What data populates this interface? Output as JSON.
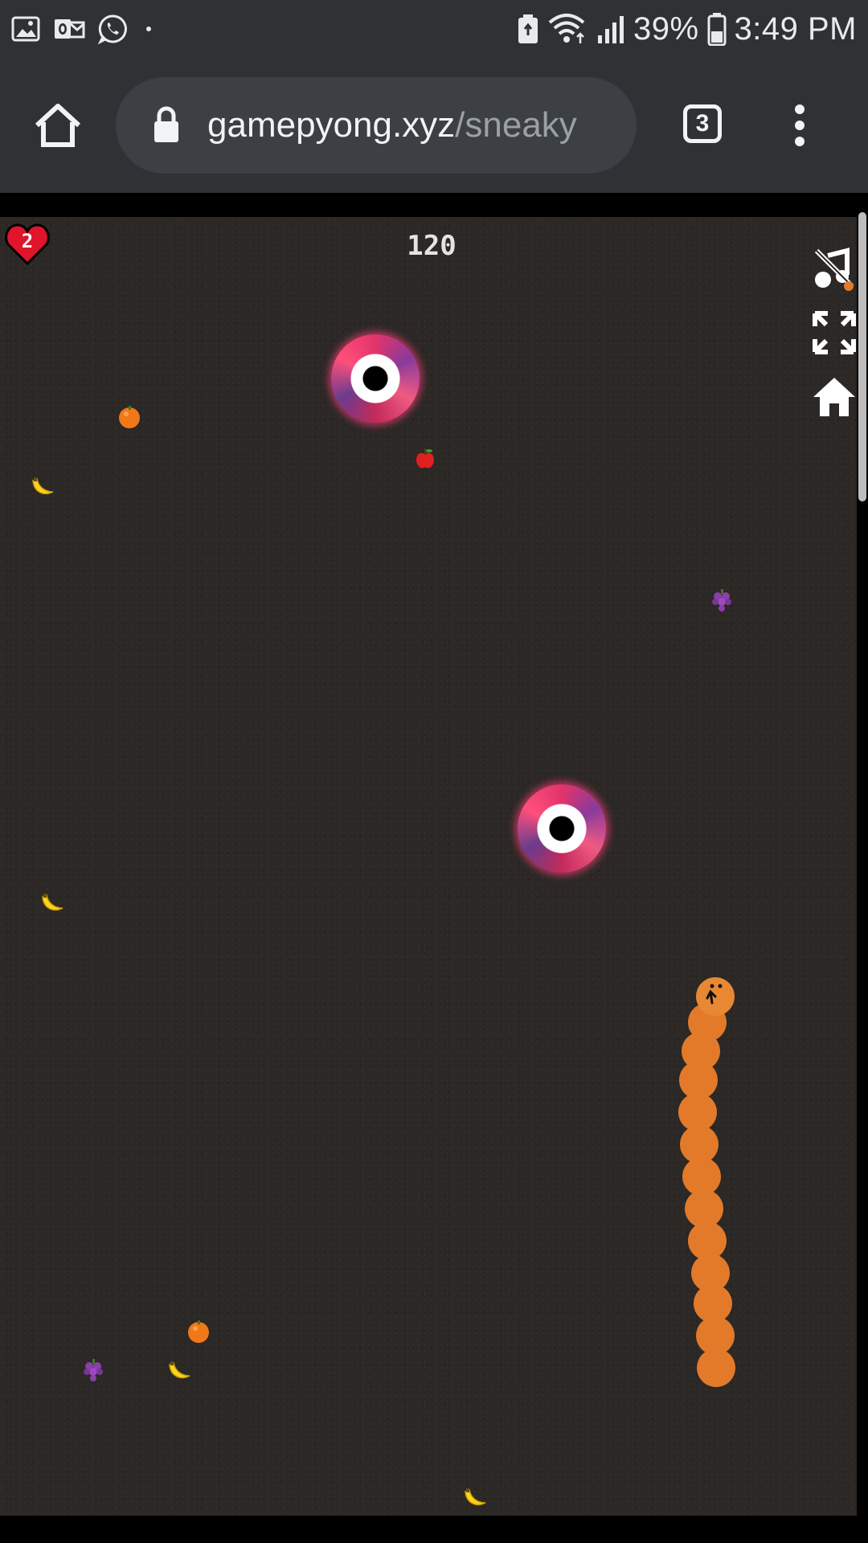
{
  "status_bar": {
    "battery_percent": "39%",
    "time": "3:49 PM",
    "icons": [
      "gallery-icon",
      "outlook-icon",
      "whatsapp-icon",
      "notification-dot-icon",
      "battery-saver-icon",
      "wifi-icon",
      "signal-icon",
      "battery-icon"
    ]
  },
  "browser": {
    "url_host": "gamepyong.xyz",
    "url_path": "/sneaky",
    "tab_count": "3",
    "icons": [
      "home-icon",
      "lock-icon",
      "tabs-icon",
      "more-vert-icon"
    ]
  },
  "game": {
    "lives": "2",
    "score": "120",
    "side_buttons": [
      "music-off-icon",
      "fullscreen-icon",
      "home-icon"
    ],
    "fruits": [
      "orange",
      "banana",
      "apple",
      "grape",
      "banana",
      "orange",
      "grape",
      "banana",
      "banana"
    ],
    "portals": 2,
    "snake_segments": 13,
    "colors": {
      "background": "#2b2826",
      "snake": "#e27a2a",
      "portal": "#e2346a",
      "heart": "#e0142a"
    }
  }
}
